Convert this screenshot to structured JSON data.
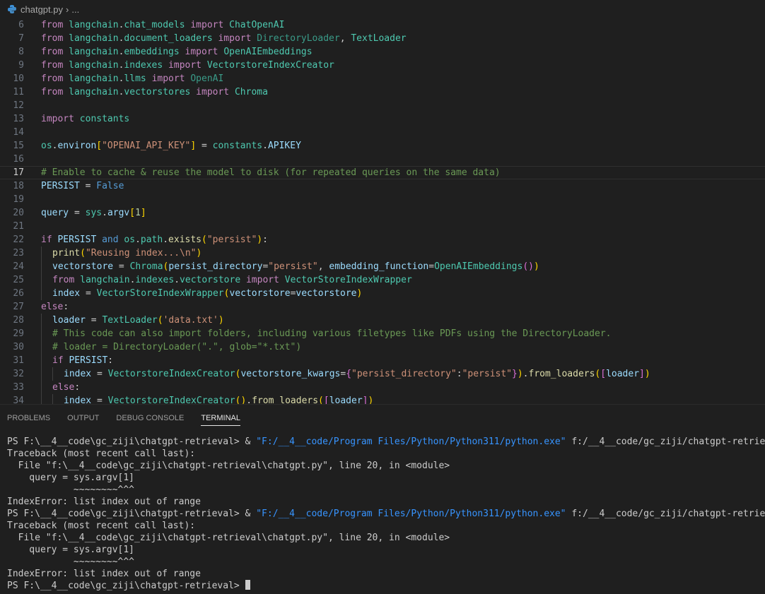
{
  "breadcrumb": {
    "file": "chatgpt.py",
    "sep": "›",
    "rest": "..."
  },
  "lines": [
    6,
    7,
    8,
    9,
    10,
    11,
    12,
    13,
    14,
    15,
    16,
    17,
    18,
    19,
    20,
    21,
    22,
    23,
    24,
    25,
    26,
    27,
    28,
    29,
    30,
    31,
    32,
    33,
    34
  ],
  "panel": {
    "tabs": [
      "PROBLEMS",
      "OUTPUT",
      "DEBUG CONSOLE",
      "TERMINAL"
    ],
    "active": "TERMINAL"
  },
  "terminal": {
    "prompt": "PS F:\\__4__code\\gc_ziji\\chatgpt-retrieval>",
    "amp": " & ",
    "exe": "\"F:/__4__code/Program Files/Python/Python311/python.exe\"",
    "script": " f:/__4__code/gc_ziji/chatgpt-retrieval/chatgpt.py",
    "tb1": "Traceback (most recent call last):",
    "tb2": "  File \"f:\\__4__code\\gc_ziji\\chatgpt-retrieval\\chatgpt.py\", line 20, in <module>",
    "tb3": "    query = sys.argv[1]",
    "tb4": "            ~~~~~~~~^^^",
    "err": "IndexError: list index out of range",
    "last_prompt": "PS F:\\__4__code\\gc_ziji\\chatgpt-retrieval> "
  }
}
